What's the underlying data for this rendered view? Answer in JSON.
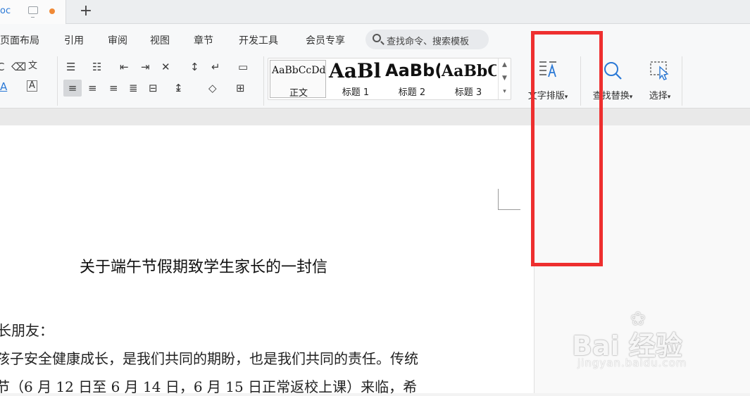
{
  "tab": {
    "doc_name": "oc",
    "new_tab": "+"
  },
  "menu": {
    "items": [
      "页面布局",
      "引用",
      "审阅",
      "视图",
      "章节",
      "开发工具",
      "会员专享"
    ],
    "search_placeholder": "查找命令、搜索模板"
  },
  "ribbon": {
    "styles": [
      {
        "preview": "AaBbCcDd",
        "name": "正文"
      },
      {
        "preview": "AaBl",
        "name": "标题 1"
      },
      {
        "preview": "AaBb(",
        "name": "标题 2"
      },
      {
        "preview": "AaBbC",
        "name": "标题 3"
      }
    ],
    "text_layout": "文字排版",
    "find_replace": "查找替换",
    "select": "选择",
    "dropdown_glyph": "▾"
  },
  "document": {
    "title": "关于端午节假期致学生家长的一封信",
    "lines": [
      "长朋友：",
      "孩子安全健康成长，是我们共同的期盼，也是我们共同的责任。传统",
      "节（6 月 12 日至 6 月 14 日，6 月 15 日正常返校上课）来临，希"
    ]
  },
  "watermark": {
    "brand": "Bai  经验",
    "site": "jingyan.baidu.com"
  },
  "colors": {
    "highlight": "#ee2f2f",
    "accent": "#2b79d6",
    "modified_dot": "#f08a37"
  }
}
